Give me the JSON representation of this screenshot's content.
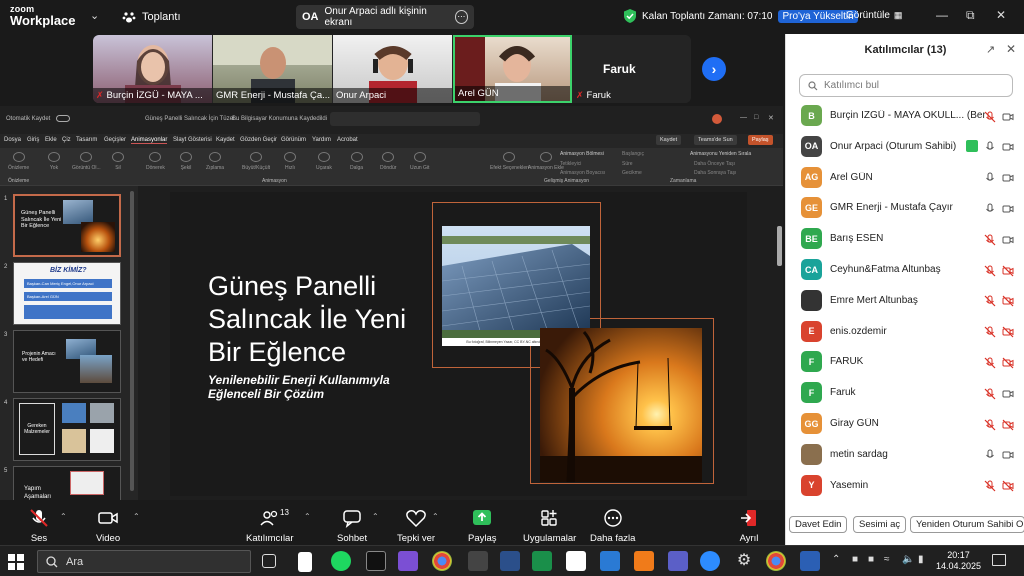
{
  "app": {
    "logo_line1": "zoom",
    "logo_line2": "Workplace",
    "meeting_label": "Toplantı",
    "viewing_badge": "OA",
    "viewing_text": "Onur Arpaci adlı kişinin ekranı",
    "timer_text": "Kalan Toplantı Zamanı: 07:10",
    "upgrade_label": "Pro'ya Yükseltin",
    "view_label": "Görüntüle"
  },
  "video_strip": {
    "tiles": [
      {
        "name": "Burçin İZGÜ - MAYA ..."
      },
      {
        "name": "GMR Enerji - Mustafa Ça..."
      },
      {
        "name": "Onur Arpaci"
      },
      {
        "name": "Arel GÜN"
      },
      {
        "name": "Faruk",
        "caption": "Faruk"
      }
    ]
  },
  "powerpoint": {
    "title_bar": [
      "Otomatik Kaydet",
      "Güneş Panelli Salıncak İçin Tüzel...",
      "Bu Bilgisayar Konumuna Kaydedildi"
    ],
    "menu": [
      "Dosya",
      "Giriş",
      "Ekle",
      "Çiz",
      "Tasarım",
      "Geçişler",
      "Animasyonlar",
      "Slayt Gösterisi",
      "Kaydet",
      "Gözden Geçir",
      "Görünüm",
      "Yardım",
      "Acrobat"
    ],
    "menu_buttons": [
      "Kaydet",
      "Teams'de Sun",
      "Paylaş"
    ],
    "ribbon_effects": [
      "Yok",
      "Görüntü Ol...",
      "Sil",
      "Şekil",
      "Dönerek",
      "Zıplama",
      "Büyüt/Küçült",
      "Hızlı",
      "Uçarak",
      "Dalga",
      "Döndür",
      "Uzun Git"
    ],
    "ribbon_groups": [
      "Önizleme",
      "Animasyon",
      "Gelişmiş Animasyon",
      "Zamanlama"
    ],
    "ribbon_side": [
      "Önizleme",
      "Efekt Seçenekleri",
      "Animasyon Ekle",
      "Animasyon Bölmesi",
      "Tetikleyici",
      "Animasyon Boyacısı",
      "Başlangıç",
      "Süre",
      "Gecikme",
      "Animasyonu Yeniden Sırala",
      "Daha Önceye Taşı",
      "Daha Sonraya Taşı"
    ],
    "slide_numbers": [
      "1",
      "2",
      "3",
      "4",
      "5"
    ],
    "thumb_texts": {
      "t1": "Güneş Panelli Salıncak İle Yeni Bir Eğlence",
      "t2_title": "BİZ KİMİZ?",
      "t2_row1": "Başkan-Can Meriç Engel,Onur Arpaci",
      "t2_row2": "Başkan-Arel GÜN",
      "t3": "Projenin Amacı ve Hedefi",
      "t4": "Gereken Malzemeler",
      "t5": "Yapım Aşamaları"
    },
    "slide": {
      "title": "Güneş Panelli Salıncak İle Yeni Bir Eğlence",
      "subtitle": "Yenilenebilir Enerji Kullanımıyla Eğlenceli Bir Çözüm",
      "photo_caption": "Bu fotoğraf, Bilinmeyen Yazar, CC BY-NC altında lisanslanmıştır"
    }
  },
  "controls": {
    "audio": "Ses",
    "video": "Video",
    "participants": "Katılımcılar",
    "participants_count": "13",
    "chat": "Sohbet",
    "react": "Tepki ver",
    "share": "Paylaş",
    "apps": "Uygulamalar",
    "more": "Daha fazla",
    "leave": "Ayrıl"
  },
  "panel": {
    "title": "Katılımcılar (13)",
    "search_placeholder": "Katılımcı bul",
    "participants": [
      {
        "initials": "B",
        "name": "Burçin İZGÜ - MAYA OKULL... (Ben)",
        "color": "#6aa84f",
        "mic": "off",
        "cam": "on"
      },
      {
        "initials": "OA",
        "name": "Onur Arpaci (Oturum Sahibi)",
        "color": "#444444",
        "mic": "on",
        "cam": "on",
        "sharing": true
      },
      {
        "initials": "AG",
        "name": "Arel GÜN",
        "color": "#e69138",
        "mic": "on",
        "cam": "on"
      },
      {
        "initials": "GE",
        "name": "GMR Enerji - Mustafa Çayır",
        "color": "#e69138",
        "mic": "on",
        "cam": "on"
      },
      {
        "initials": "BE",
        "name": "Barış ESEN",
        "color": "#2fa84f",
        "mic": "off",
        "cam": "on"
      },
      {
        "initials": "CA",
        "name": "Ceyhun&Fatma Altunbaş",
        "color": "#1aa39a",
        "mic": "off",
        "cam": "off"
      },
      {
        "initials": "",
        "name": "Emre Mert Altunbaş",
        "color": "#333333",
        "mic": "off",
        "cam": "off"
      },
      {
        "initials": "E",
        "name": "enis.ozdemir",
        "color": "#d9432e",
        "mic": "off",
        "cam": "off"
      },
      {
        "initials": "F",
        "name": "FARUK",
        "color": "#2fa84f",
        "mic": "off",
        "cam": "off"
      },
      {
        "initials": "F",
        "name": "Faruk",
        "color": "#2fa84f",
        "mic": "off",
        "cam": "on"
      },
      {
        "initials": "GG",
        "name": "Giray GÜN",
        "color": "#e69138",
        "mic": "off",
        "cam": "off"
      },
      {
        "initials": "",
        "name": "metin sardag",
        "color": "#8a6f4e",
        "mic": "on",
        "cam": "on"
      },
      {
        "initials": "Y",
        "name": "Yasemin",
        "color": "#d9432e",
        "mic": "off",
        "cam": "off"
      }
    ],
    "footer": [
      "Davet Edin",
      "Sesimi aç",
      "Yeniden Oturum Sahibi O"
    ]
  },
  "taskbar": {
    "search_placeholder": "Ara",
    "time": "20:17",
    "date": "14.04.2025"
  }
}
